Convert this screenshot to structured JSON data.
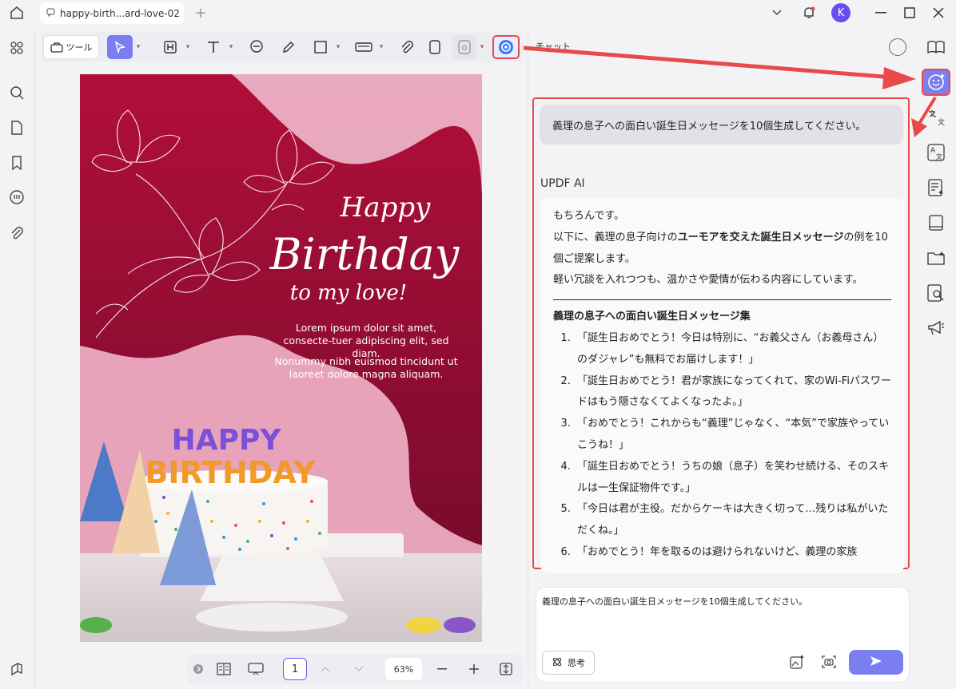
{
  "tab": {
    "title": "happy-birth...ard-love-02"
  },
  "toolbar": {
    "tool_label": "ツール"
  },
  "card": {
    "happy": "Happy",
    "birthday": "Birthday",
    "to_my_love": "to my love!",
    "para1": "Lorem ipsum dolor sit amet, consecte-tuer adipiscing elit, sed diam.",
    "para2": "Nonummy nibh euismod tincidunt ut laoreet dolore magna aliquam.",
    "cake_top": "HAPPY",
    "cake_bottom": "BIRTHDAY"
  },
  "bottombar": {
    "page": "1",
    "zoom": "63%"
  },
  "avatar": {
    "initial": "K"
  },
  "chat": {
    "title": "チャット",
    "user_message": "義理の息子への面白い誕生日メッセージを10個生成してください。",
    "ai_label": "UPDF AI",
    "intro1": "もちろんです。",
    "intro2_a": "以下に、義理の息子向けの",
    "intro2_b": "ユーモアを交えた誕生日メッセージ",
    "intro2_c": "の例を10個ご提案します。",
    "intro3": "軽い冗談を入れつつも、温かさや愛情が伝わる内容にしています。",
    "heading": "義理の息子への面白い誕生日メッセージ集",
    "items": [
      "「誕生日おめでとう！今日は特別に、“お義父さん（お義母さん）のダジャレ”も無料でお届けします！」",
      "「誕生日おめでとう！君が家族になってくれて、家のWi-Fiパスワードはもう隠さなくてよくなったよ。」",
      "「おめでとう！これからも“義理”じゃなく、“本気”で家族やっていこうね！」",
      "「誕生日おめでとう！うちの娘（息子）を笑わせ続ける、そのスキルは一生保証物件です。」",
      "「今日は君が主役。だからケーキは大きく切って…残りは私がいただくね。」",
      "「おめでとう！年を取るのは避けられないけど、義理の家族"
    ],
    "input_text": "義理の息子への面白い誕生日メッセージを10個生成してください。",
    "think_label": "思考"
  }
}
